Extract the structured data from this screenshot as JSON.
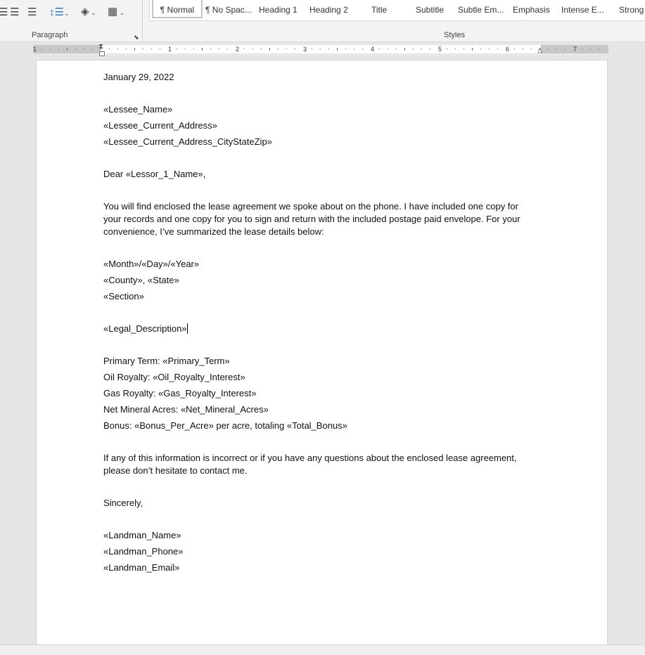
{
  "ribbon": {
    "paragraph_group": {
      "label": "Paragraph",
      "icons": [
        "align-center-icon",
        "align-right-icon",
        "justify-icon",
        "line-spacing-icon",
        "shading-icon",
        "borders-icon",
        "dialog-launcher-icon"
      ]
    },
    "styles_group": {
      "label": "Styles",
      "items": [
        "¶ Normal",
        "¶ No Spac...",
        "Heading 1",
        "Heading 2",
        "Title",
        "Subtitle",
        "Subtle Em...",
        "Emphasis",
        "Intense E...",
        "Strong"
      ],
      "selected": "¶ Normal"
    }
  },
  "ruler": {
    "numbers": [
      "1",
      "1",
      "2",
      "3",
      "4",
      "5",
      "6",
      "7"
    ]
  },
  "document": {
    "date": "January 29, 2022",
    "address": [
      "«Lessee_Name»",
      "«Lessee_Current_Address»",
      "«Lessee_Current_Address_CityStateZip»"
    ],
    "salutation": "Dear «Lessor_1_Name»,",
    "intro": [
      "You will find enclosed the lease agreement we spoke about on the phone. I have included one copy for",
      "your records and one copy for you to sign and return with the included postage paid envelope. For your",
      "convenience, I’ve summarized the lease details below:"
    ],
    "date_fields": "«Month»/«Day»/«Year»",
    "county_state": "«County», «State»",
    "section": "«Section»",
    "legal": "«Legal_Description»",
    "details": [
      "Primary Term:  «Primary_Term»",
      "Oil Royalty:  «Oil_Royalty_Interest»",
      "Gas Royalty:  «Gas_Royalty_Interest»",
      "Net Mineral Acres:  «Net_Mineral_Acres»",
      "Bonus:  «Bonus_Per_Acre» per acre, totaling «Total_Bonus»"
    ],
    "closing": [
      "If any of this information is incorrect or if you have any questions about the enclosed lease agreement,",
      "please don’t hesitate to contact me."
    ],
    "signoff": "Sincerely,",
    "signature": [
      "«Landman_Name»",
      "«Landman_Phone»",
      "«Landman_Email»"
    ]
  }
}
